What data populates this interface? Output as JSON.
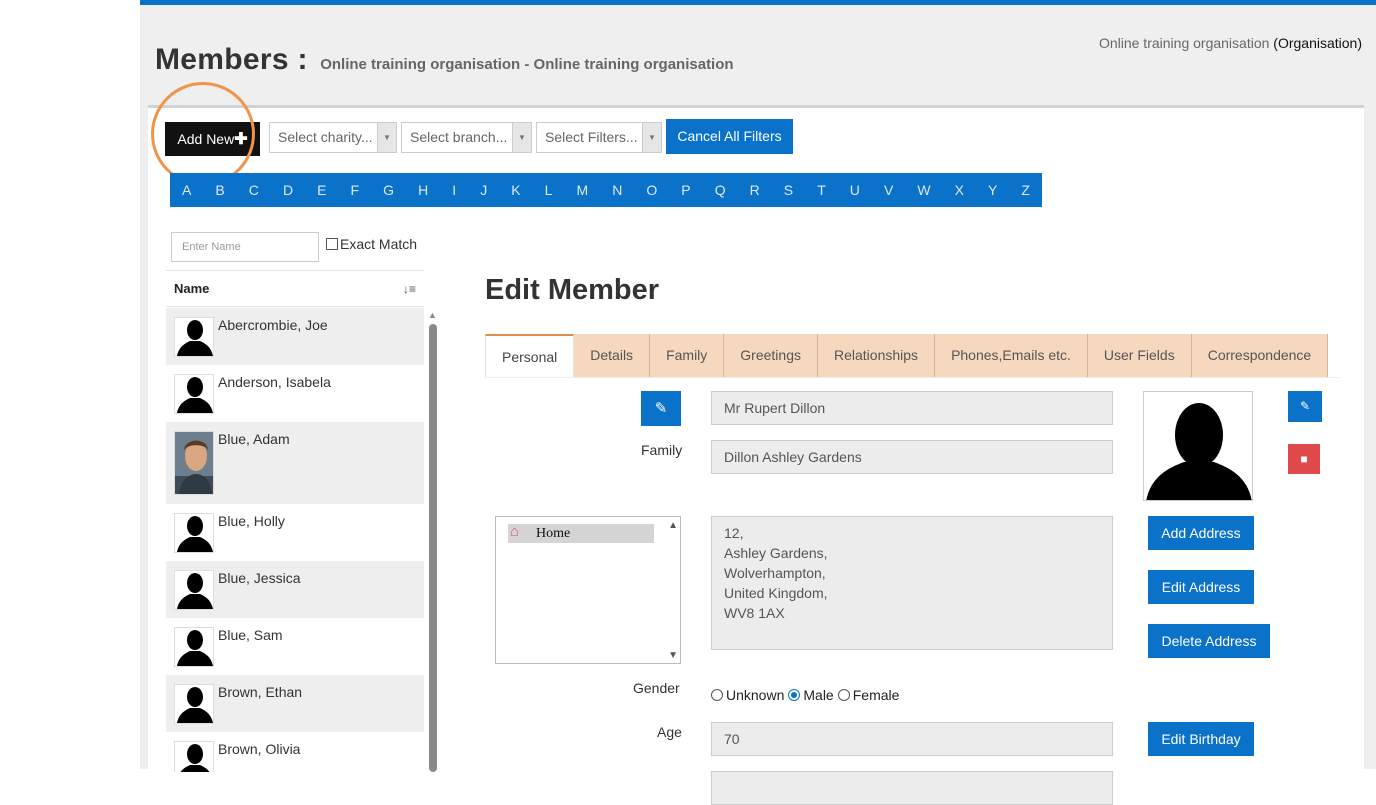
{
  "header": {
    "title": "Members :",
    "subtitle": "Online training organisation - Online training organisation",
    "org_name": "Online training organisation",
    "org_type": "(Organisation)"
  },
  "toolbar": {
    "add_new_label": "Add New",
    "add_icon": "plus-icon",
    "charity_select": "Select charity...",
    "branch_select": "Select branch...",
    "filters_select": "Select Filters...",
    "cancel_filters_label": "Cancel All Filters"
  },
  "alphabet": [
    "A",
    "B",
    "C",
    "D",
    "E",
    "F",
    "G",
    "H",
    "I",
    "J",
    "K",
    "L",
    "M",
    "N",
    "O",
    "P",
    "Q",
    "R",
    "S",
    "T",
    "U",
    "V",
    "W",
    "X",
    "Y",
    "Z"
  ],
  "search": {
    "name_placeholder": "Enter Name",
    "exact_match_label": "Exact Match",
    "exact_match_checked": false
  },
  "member_list": {
    "column_header": "Name",
    "sort_icon": "sort-alpha-icon",
    "members": [
      {
        "name": "Abercrombie, Joe",
        "avatar": "silhouette"
      },
      {
        "name": "Anderson, Isabela",
        "avatar": "silhouette"
      },
      {
        "name": "Blue, Adam",
        "avatar": "photo"
      },
      {
        "name": "Blue, Holly",
        "avatar": "silhouette"
      },
      {
        "name": "Blue, Jessica",
        "avatar": "silhouette"
      },
      {
        "name": "Blue, Sam",
        "avatar": "silhouette"
      },
      {
        "name": "Brown, Ethan",
        "avatar": "silhouette"
      },
      {
        "name": "Brown, Olivia",
        "avatar": "silhouette"
      }
    ]
  },
  "edit_member": {
    "title": "Edit Member",
    "tabs": [
      "Personal",
      "Details",
      "Family",
      "Greetings",
      "Relationships",
      "Phones,Emails etc.",
      "User Fields",
      "Correspondence"
    ],
    "active_tab": "Personal",
    "full_name": "Mr Rupert Dillon",
    "family_label": "Family",
    "family_value": "Dillon Ashley Gardens",
    "address_list_item": "Home",
    "address_lines": [
      "12,",
      "Ashley Gardens,",
      "Wolverhampton,",
      "United Kingdom,",
      "WV8 1AX"
    ],
    "add_address_label": "Add Address",
    "edit_address_label": "Edit Address",
    "delete_address_label": "Delete Address",
    "gender_label": "Gender",
    "gender_options": [
      "Unknown",
      "Male",
      "Female"
    ],
    "gender_selected": "Male",
    "age_label": "Age",
    "age_value": "70",
    "edit_birthday_label": "Edit Birthday"
  },
  "colors": {
    "primary_blue": "#0a72c9",
    "tab_bg": "#f6d8bf",
    "delete_red": "#e04a4a",
    "highlight_ring": "#f0944a"
  }
}
